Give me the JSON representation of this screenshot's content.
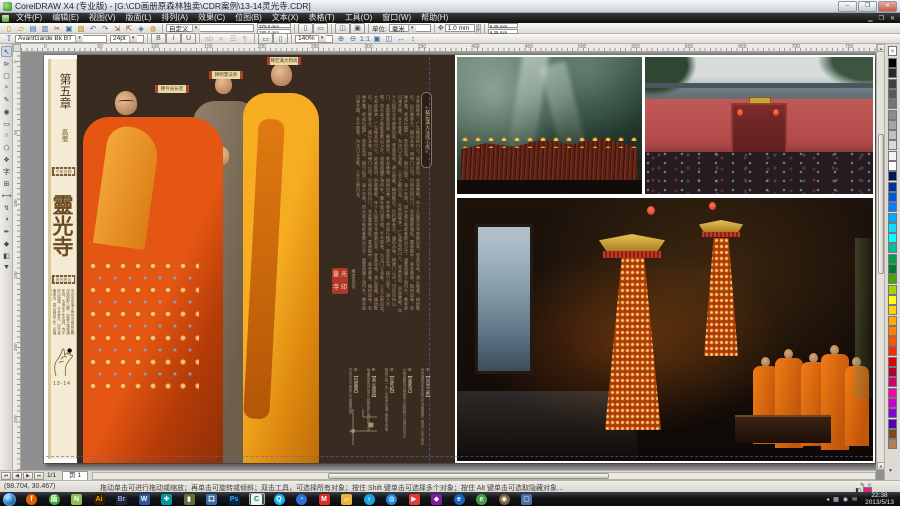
{
  "window": {
    "title": "CorelDRAW X4 (专业版) - [G:\\CD画册原森林独卖\\CDR案例\\13-14灵光寺.CDR]",
    "buttons": {
      "minimize": "–",
      "maximize": "❐",
      "close": "✕"
    }
  },
  "menu": {
    "items": [
      {
        "key": "file",
        "label": "文件(F)"
      },
      {
        "key": "edit",
        "label": "编辑(E)"
      },
      {
        "key": "view",
        "label": "视图(V)"
      },
      {
        "key": "layout",
        "label": "版面(L)"
      },
      {
        "key": "arrange",
        "label": "排列(A)"
      },
      {
        "key": "effects",
        "label": "效果(C)"
      },
      {
        "key": "bitmaps",
        "label": "位图(B)"
      },
      {
        "key": "text",
        "label": "文本(X)"
      },
      {
        "key": "table",
        "label": "表格(T)"
      },
      {
        "key": "tools",
        "label": "工具(O)"
      },
      {
        "key": "window",
        "label": "窗口(W)"
      },
      {
        "key": "help",
        "label": "帮助(H)"
      }
    ],
    "doc_buttons": [
      "▁",
      "❐",
      "✕"
    ]
  },
  "toolbar_standard": {
    "icons": [
      {
        "name": "new-icon",
        "glyph": "▯",
        "c": "c1"
      },
      {
        "name": "open-icon",
        "glyph": "▱",
        "c": "c1"
      },
      {
        "name": "save-icon",
        "glyph": "▤",
        "c": "c2"
      },
      {
        "name": "print-icon",
        "glyph": "▥",
        "c": "c2"
      },
      {
        "name": "cut-icon",
        "glyph": "✂",
        "c": "c3"
      },
      {
        "name": "copy-icon",
        "glyph": "▣",
        "c": "c2"
      },
      {
        "name": "paste-icon",
        "glyph": "▨",
        "c": "c1"
      },
      {
        "name": "undo-icon",
        "glyph": "↶",
        "c": "c2"
      },
      {
        "name": "redo-icon",
        "glyph": "↷",
        "c": "c2"
      },
      {
        "name": "import-icon",
        "glyph": "⇲",
        "c": "c3"
      },
      {
        "name": "export-icon",
        "glyph": "⇱",
        "c": "c3"
      },
      {
        "name": "app-launcher-icon",
        "glyph": "◈",
        "c": "c2"
      },
      {
        "name": "welcome-icon",
        "glyph": "◍",
        "c": "c1"
      }
    ],
    "preset_value": "自定义",
    "page_w": "370.0 mm",
    "page_h": "285.0 mm",
    "units_label": "单位:",
    "units_value": "毫米",
    "nudge_value": "1.0 mm",
    "dup_x": "6.35 mm",
    "dup_y": "6.35 mm"
  },
  "toolbar_text": {
    "font_name": "AvantGarde Bk BT",
    "font_size": "24pt",
    "style_buttons": [
      "B",
      "I",
      "U"
    ],
    "para_icons": [
      "ab",
      "≡",
      "☰",
      "¶"
    ],
    "dir_buttons": [
      "▭",
      "▯"
    ],
    "zoom_level": "140%",
    "zoom_icons": [
      "⊕",
      "⊖",
      "1:1",
      "▣",
      "◫",
      "↔",
      "↕"
    ]
  },
  "rulers": {
    "h_labels": [
      "0",
      "50",
      "100",
      "150",
      "200",
      "250",
      "300",
      "350",
      "400",
      "450",
      "500",
      "550",
      "600",
      "650",
      "700",
      "750"
    ],
    "v_labels": [
      "0",
      "50",
      "100",
      "150",
      "200",
      "250"
    ]
  },
  "toolbox": {
    "tools": [
      {
        "name": "pick-tool",
        "glyph": "↖"
      },
      {
        "name": "shape-tool",
        "glyph": "⊳"
      },
      {
        "name": "crop-tool",
        "glyph": "▢"
      },
      {
        "name": "zoom-tool",
        "glyph": "⌕"
      },
      {
        "name": "freehand-tool",
        "glyph": "✎"
      },
      {
        "name": "smart-fill-tool",
        "glyph": "◉"
      },
      {
        "name": "rectangle-tool",
        "glyph": "▭"
      },
      {
        "name": "ellipse-tool",
        "glyph": "○"
      },
      {
        "name": "polygon-tool",
        "glyph": "⬠"
      },
      {
        "name": "basic-shapes-tool",
        "glyph": "❖"
      },
      {
        "name": "text-tool",
        "glyph": "字"
      },
      {
        "name": "table-tool",
        "glyph": "⊞"
      },
      {
        "name": "dimension-tool",
        "glyph": "⟷"
      },
      {
        "name": "connector-tool",
        "glyph": "↯"
      },
      {
        "name": "blend-tool",
        "glyph": "◑"
      },
      {
        "name": "eyedropper-tool",
        "glyph": "✒"
      },
      {
        "name": "outline-tool",
        "glyph": "◆"
      },
      {
        "name": "fill-tool",
        "glyph": "◧"
      },
      {
        "name": "interactive-fill-tool",
        "glyph": "▼"
      }
    ]
  },
  "palette": {
    "colors": [
      "#000000",
      "#262626",
      "#404040",
      "#595959",
      "#737373",
      "#8c8c8c",
      "#a6a6a6",
      "#bfbfbf",
      "#d9d9d9",
      "#f2f2f2",
      "#ffffff",
      "#001a4d",
      "#0033a0",
      "#0055d4",
      "#0080ff",
      "#00aaff",
      "#00e0ff",
      "#00ffff",
      "#00bfa0",
      "#00a050",
      "#007a2f",
      "#4ca600",
      "#a6d400",
      "#ffff00",
      "#ffd400",
      "#ffaa00",
      "#ff8000",
      "#ff5500",
      "#ff2a00",
      "#e00000",
      "#b00030",
      "#d4006a",
      "#ff00aa",
      "#cc00cc",
      "#8800dd",
      "#5500aa",
      "#7a4a22",
      "#b08050"
    ]
  },
  "document": {
    "chapter": "第五章",
    "chapter_sub": "高僧",
    "band1_label": "千年古刹",
    "band2_label": "灵光名山",
    "calligraphy": "靈光寺",
    "strip_para": "灵光寺坐落于梅州市梅县区雁洋镇阴那山麓，创建于唐咸通年间，为粤东千年名刹。寺宇依山而建，古木参天，历代高僧辈出，香火绵延千年，名播海内外。",
    "folio": "13-14",
    "monk_tags": [
      "释今光长老",
      "释明慧法师",
      "释宏满大和尚"
    ],
    "cartouche_title": "释宏满大法师小传",
    "body_text": "大师俗姓李，广东梅县松口人。幼承庭训，夙具慧根。年十九投灵光寺披剃出家，受具足戒，潜心经藏，精研毗尼。后行脚参方，遍历丛林，得禅门心印。归而住持山门，发愿重辉祖庭，募建殿宇，装金佛像，植树造林，农禅并重。师戒行精严，悲愿宏深，接引后学，诲人不倦。四众弟子皈依者数以万计，道誉遐播于海内外。晚年犹日课不辍，手不释卷，为法门之龙象，人天之眼目云。",
    "seal_text": "靈光寺印",
    "seal_side": "梅州灵光寺",
    "footnotes": [
      {
        "num": "①",
        "title": "【灵光三绝】",
        "body": "寺内菠萝顶生死柏无叶顶盖堪称三绝游人无不称奇"
      },
      {
        "num": "②",
        "title": "【菠萝顶】",
        "body": "大雄宝殿藻井螺旋而上结构精巧为国内所罕见"
      },
      {
        "num": "③",
        "title": "【生死柏】",
        "body": "殿前古柏一生一死相传为潘了拳亲手所植"
      },
      {
        "num": "④",
        "title": "【香火鼎盛】",
        "body": "每逢朔望四方信众云集焚香礼佛祈福消灾"
      },
      {
        "num": "⑤",
        "title": "【位置图】",
        "body": "灵光寺位于阴那山五指峰西麓"
      }
    ]
  },
  "page_nav": {
    "counter": "1/1",
    "tab": "页 1",
    "arrows": [
      "⏮",
      "◀",
      "▶",
      "⏭"
    ]
  },
  "status_bar": {
    "coords": "(98.704, 30.467)",
    "hint": "拖动单击可进行拖动或缩放；再单击可旋转或倾斜；双击工具，可选择所有对象；按住 Shift 键单击可选择多个对象；按住 Alt 键单击可选取隐藏对象…",
    "outline_state": "✕",
    "fill_color": "#e0218a"
  },
  "taskbar": {
    "apps": [
      {
        "name": "firefox",
        "label": "f",
        "bg": "#e66000",
        "shape": "circle"
      },
      {
        "name": "360-safe",
        "label": "盾",
        "bg": "#3cb034",
        "shape": "circle"
      },
      {
        "name": "notepad",
        "label": "N",
        "bg": "#8bc34a",
        "shape": "square"
      },
      {
        "name": "illustrator",
        "label": "Ai",
        "bg": "#2b1d00",
        "fg": "#ff9a00",
        "shape": "square"
      },
      {
        "name": "bridge",
        "label": "Br",
        "bg": "#23233d",
        "fg": "#9aa7c7",
        "shape": "square"
      },
      {
        "name": "word",
        "label": "W",
        "bg": "#2b579a",
        "shape": "square"
      },
      {
        "name": "teal-tool",
        "label": "✚",
        "bg": "#009a9a",
        "shape": "square"
      },
      {
        "name": "folder-dark",
        "label": "▮",
        "bg": "#6b6b3a",
        "shape": "square"
      },
      {
        "name": "app-blue",
        "label": "口",
        "bg": "#3a6ea5",
        "shape": "square"
      },
      {
        "name": "photoshop",
        "label": "Ps",
        "bg": "#05253d",
        "fg": "#31a8ff",
        "shape": "square"
      },
      {
        "name": "coreldraw",
        "label": "C",
        "bg": "#f2f2f2",
        "fg": "#00923f",
        "shape": "square",
        "active": true
      },
      {
        "name": "qq",
        "label": "Q",
        "bg": "#12b7f5",
        "shape": "circle"
      },
      {
        "name": "compass-browser",
        "label": "◔",
        "bg": "#2a6fd6",
        "shape": "circle"
      },
      {
        "name": "foxmail",
        "label": "M",
        "bg": "#d93025",
        "shape": "square"
      },
      {
        "name": "folder-yellow",
        "label": "▱",
        "bg": "#e8b339",
        "shape": "square"
      },
      {
        "name": "bird-app",
        "label": "›",
        "bg": "#15a4e6",
        "shape": "circle"
      },
      {
        "name": "globe",
        "label": "◍",
        "bg": "#1e88e5",
        "shape": "circle"
      },
      {
        "name": "pps",
        "label": "▶",
        "bg": "#e53935",
        "shape": "square"
      },
      {
        "name": "app-purple",
        "label": "◆",
        "bg": "#7b1fa2",
        "shape": "square"
      },
      {
        "name": "ie",
        "label": "e",
        "bg": "#1565c0",
        "shape": "circle"
      },
      {
        "name": "browser-green",
        "label": "e",
        "bg": "#43a047",
        "shape": "circle"
      },
      {
        "name": "picasa",
        "label": "◉",
        "bg": "#7b5e3a",
        "shape": "circle"
      },
      {
        "name": "computer",
        "label": "▢",
        "bg": "#4a6fa5",
        "shape": "square"
      }
    ],
    "tray_icons": [
      "◂",
      "▦",
      "◉",
      "✉"
    ],
    "time": "22:38",
    "date": "2013/5/13"
  }
}
